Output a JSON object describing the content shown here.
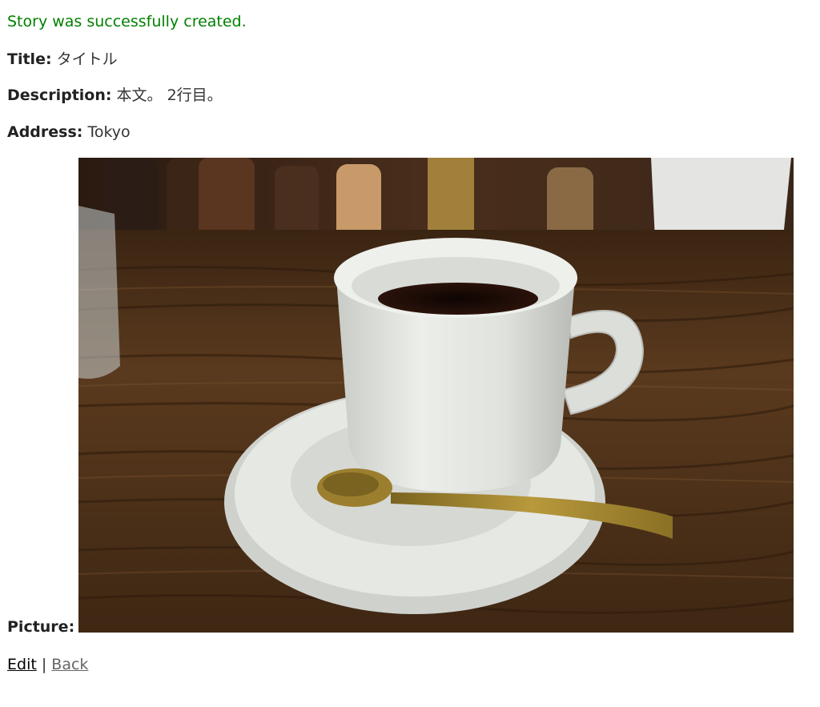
{
  "notice": "Story was successfully created.",
  "fields": {
    "title": {
      "label": "Title:",
      "value": "タイトル"
    },
    "description": {
      "label": "Description:",
      "value": "本文。 2行目。"
    },
    "address": {
      "label": "Address:",
      "value": "Tokyo"
    },
    "picture": {
      "label": "Picture:"
    }
  },
  "colors": {
    "notice": "#008000",
    "table_wood": "#5a3a1e",
    "cup": "#e4e5e1",
    "coffee": "#1a0a05",
    "spoon": "#a8892f"
  },
  "links": {
    "edit": "Edit",
    "separator": "|",
    "back": "Back"
  }
}
